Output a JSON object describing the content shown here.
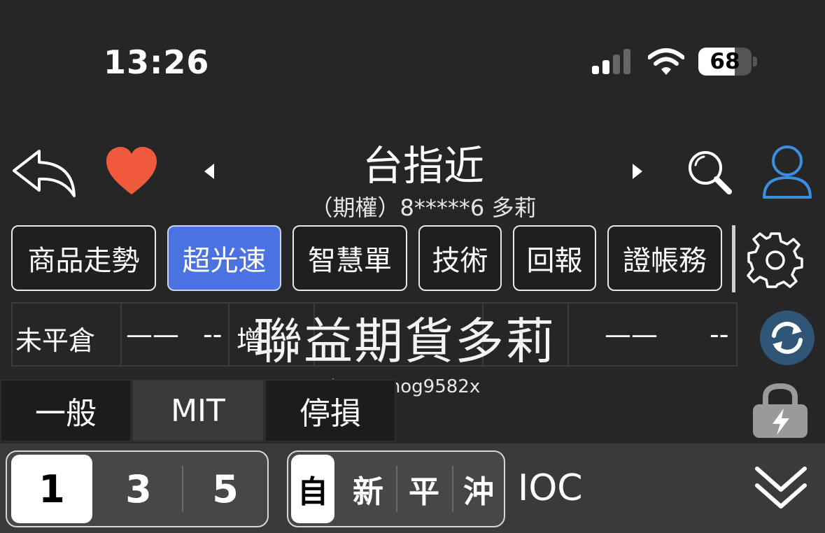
{
  "status": {
    "time": "13:26",
    "battery": "68",
    "battery_level": 68
  },
  "header": {
    "title": "台指近",
    "subtitle": "（期權）8*****6  多莉"
  },
  "tabs": [
    {
      "label": "商品走勢",
      "active": false
    },
    {
      "label": "超光速",
      "active": true
    },
    {
      "label": "智慧單",
      "active": false
    },
    {
      "label": "技術",
      "active": false
    },
    {
      "label": "回報",
      "active": false
    },
    {
      "label": "證帳務",
      "active": false
    }
  ],
  "grid": {
    "label": "未平倉",
    "dash1": "——",
    "dash2": "--",
    "overlap": "增",
    "dash3": "——",
    "dash4": "--"
  },
  "watermark": {
    "main": "聯益期貨多莉",
    "line": "Line:@mog9582x"
  },
  "order_types": [
    {
      "label": "一般",
      "active": false
    },
    {
      "label": "MIT",
      "active": true
    },
    {
      "label": "停損",
      "active": false
    }
  ],
  "quantity": [
    {
      "label": "1",
      "selected": true
    },
    {
      "label": "3",
      "selected": false
    },
    {
      "label": "5",
      "selected": false
    }
  ],
  "open_close": [
    {
      "label": "自",
      "selected": true
    },
    {
      "label": "新",
      "selected": false
    },
    {
      "label": "平",
      "selected": false
    },
    {
      "label": "沖",
      "selected": false
    }
  ],
  "ioc": "IOC",
  "colors": {
    "accent": "#4a72e0",
    "heart": "#f05a3c",
    "user": "#3b8fe0"
  }
}
